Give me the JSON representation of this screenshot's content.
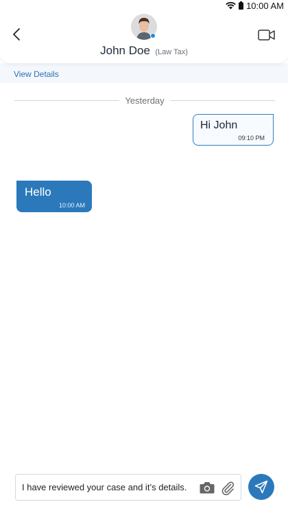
{
  "status_bar": {
    "time": "10:00 AM"
  },
  "header": {
    "contact_name": "John Doe",
    "contact_role": "(Law Tax)",
    "online_color": "#1f8de0"
  },
  "details": {
    "link_label": "View Details"
  },
  "conversation": {
    "date_separator": "Yesterday",
    "messages": [
      {
        "direction": "outgoing",
        "text": "Hi John",
        "time": "09:10 PM"
      },
      {
        "direction": "incoming",
        "text": "Hello",
        "time": "10:00 AM"
      }
    ]
  },
  "composer": {
    "value": "I have reviewed your case and it’s details."
  },
  "colors": {
    "accent": "#2b79bb",
    "link": "#2a6fb4"
  }
}
